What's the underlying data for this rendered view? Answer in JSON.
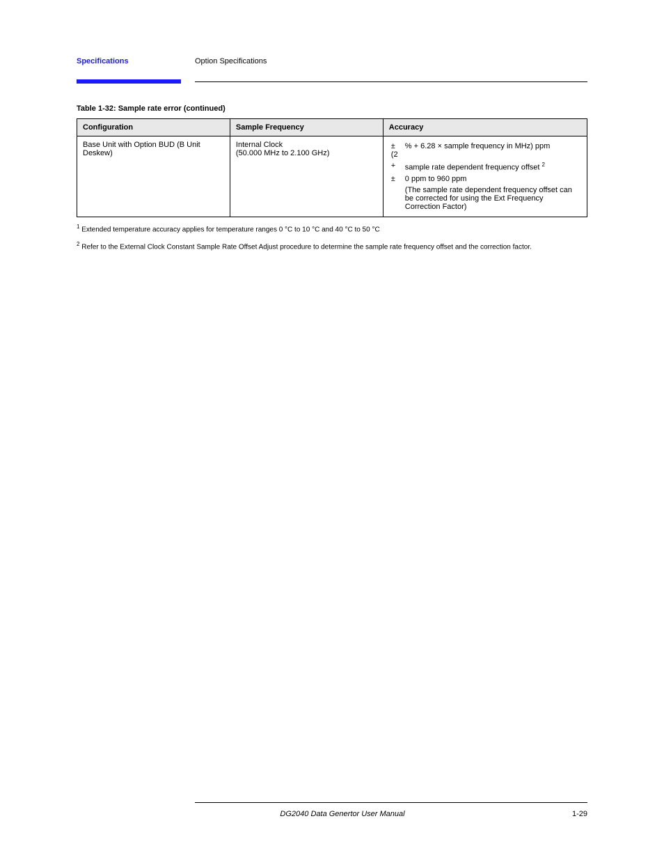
{
  "header": {
    "linkText": "Specifications",
    "rightText": "Option Specifications"
  },
  "tableCaption": "Table 1-32: Sample rate error (continued)",
  "columns": {
    "c1": "Configuration",
    "c2": "Sample Frequency",
    "c3": "Accuracy"
  },
  "row": {
    "config": "Base Unit with Option BUD (B Unit Deskew)",
    "freqLabel": "Internal Clock",
    "freqRange": "(50.000 MHz to 2.100 GHz)",
    "a1_prefix": "±(2",
    "a1_percent": "%",
    "a1_plus": "+ 6.28",
    "a1_times": "×",
    "a1_suffix": "sample frequency in MHz) ppm",
    "a2_prefix": "+",
    "a2_suffix": " sample rate dependent frequency offset ",
    "a2_fn": "2",
    "a3_prefix": "±",
    "a3_rest": "0 ppm to 960 ppm",
    "a4": "(The sample rate dependent frequency offset can be corrected for using the Ext Frequency Correction Factor)"
  },
  "footnotes": {
    "f1_num": "1",
    "f1_text": "Extended temperature accuracy applies for temperature ranges 0 °C to 10 °C and 40 °C to 50 °C",
    "f2_num": "2",
    "f2_text": "Refer to the External Clock Constant Sample Rate Offset Adjust procedure to determine the sample rate frequency offset and the correction factor."
  },
  "footer": {
    "left": "",
    "center": "DG2040 Data Genertor User Manual",
    "right": "1-29"
  }
}
